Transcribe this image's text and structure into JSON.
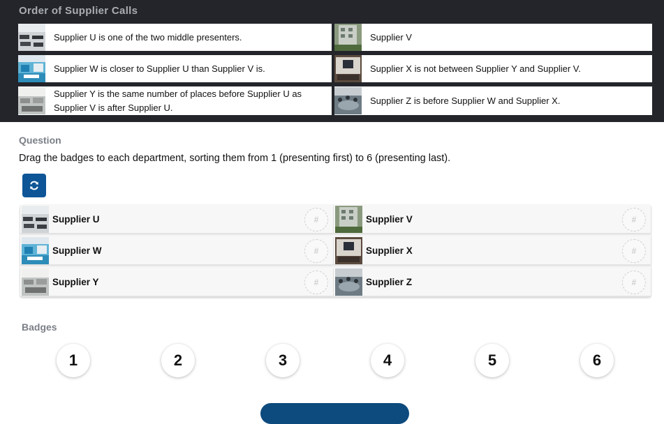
{
  "clues": {
    "title": "Order of Supplier Calls",
    "items": [
      {
        "text": "Supplier U is one of the two middle presenters.",
        "thumb": "classroom-thumbnail"
      },
      {
        "text": "Supplier V",
        "thumb": "building-thumbnail"
      },
      {
        "text": "Supplier W is closer to Supplier U than Supplier V is.",
        "thumb": "office-blue-thumbnail"
      },
      {
        "text": "Supplier X is not between Supplier Y and Supplier V.",
        "thumb": "conference-room-thumbnail"
      },
      {
        "text": "Supplier Y is the same number of places before Supplier U as Supplier V is after Supplier U.",
        "thumb": "open-office-thumbnail"
      },
      {
        "text": "Supplier Z is before Supplier W and Supplier X.",
        "thumb": "meeting-thumbnail"
      }
    ]
  },
  "question": {
    "heading": "Question",
    "text": "Drag the badges to each department, sorting them from 1 (presenting first) to 6 (presenting last).",
    "reset_icon": "refresh-icon"
  },
  "slots": [
    {
      "name": "Supplier U",
      "thumb": "classroom-thumbnail",
      "target": "#"
    },
    {
      "name": "Supplier V",
      "thumb": "building-thumbnail",
      "target": "#"
    },
    {
      "name": "Supplier W",
      "thumb": "office-blue-thumbnail",
      "target": "#"
    },
    {
      "name": "Supplier X",
      "thumb": "conference-room-thumbnail",
      "target": "#"
    },
    {
      "name": "Supplier Y",
      "thumb": "open-office-thumbnail",
      "target": "#"
    },
    {
      "name": "Supplier Z",
      "thumb": "meeting-thumbnail",
      "target": "#"
    }
  ],
  "badges": {
    "heading": "Badges",
    "items": [
      "1",
      "2",
      "3",
      "4",
      "5",
      "6"
    ]
  },
  "colors": {
    "panel_bg": "#23252a",
    "accent": "#0d5596",
    "muted_heading": "#7a7f86"
  }
}
